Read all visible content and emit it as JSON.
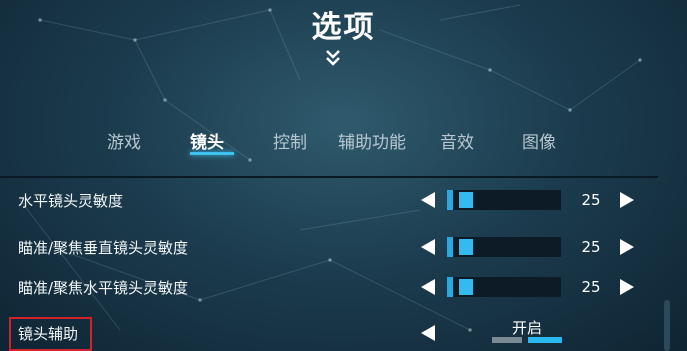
{
  "title": "选项",
  "tabs": [
    {
      "label": "游戏",
      "active": false
    },
    {
      "label": "镜头",
      "active": true
    },
    {
      "label": "控制",
      "active": false
    },
    {
      "label": "辅助功能",
      "active": false
    },
    {
      "label": "音效",
      "active": false
    },
    {
      "label": "图像",
      "active": false
    }
  ],
  "settings": [
    {
      "label": "水平镜头灵敏度",
      "type": "slider",
      "value": "25",
      "fraction": 0.12
    },
    {
      "label": "瞄准/聚焦垂直镜头灵敏度",
      "type": "slider",
      "value": "25",
      "fraction": 0.12
    },
    {
      "label": "瞄准/聚焦水平镜头灵敏度",
      "type": "slider",
      "value": "25",
      "fraction": 0.12
    },
    {
      "label": "镜头辅助",
      "type": "toggle",
      "value": "开启",
      "on": true
    }
  ],
  "colors": {
    "accent": "#35b9ee",
    "highlight": "#d2232a"
  },
  "icons": {
    "collapse": "double-chevron-down-icon",
    "decrease": "triangle-left-icon",
    "increase": "triangle-right-icon"
  }
}
